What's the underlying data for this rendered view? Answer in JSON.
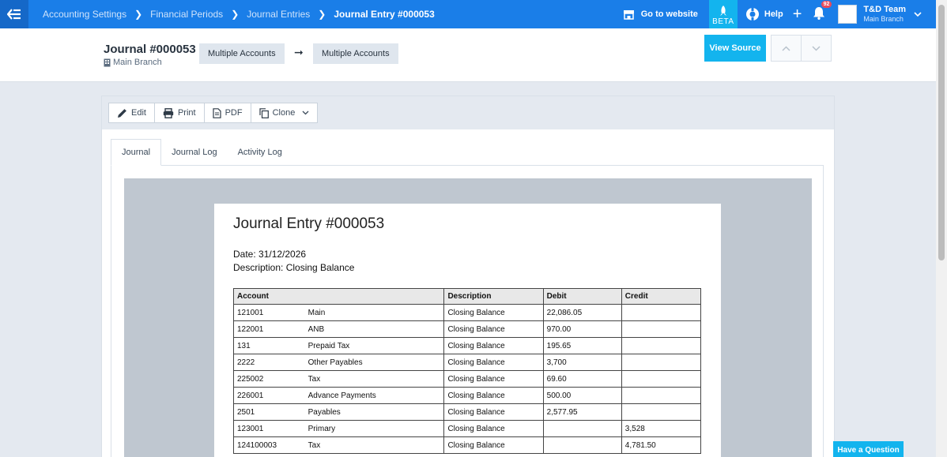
{
  "nav": {
    "menu_icon": "menu-arrow-left-icon",
    "breadcrumb": [
      "Accounting Settings",
      "Financial Periods",
      "Journal Entries",
      "Journal Entry #000053"
    ],
    "go_to_website": "Go to website",
    "beta": "BETA",
    "help": "Help",
    "notifications_count": "92",
    "user_name": "T&D Team",
    "user_branch": "Main Branch"
  },
  "header": {
    "title": "Journal #000053",
    "branch": "Main Branch",
    "from_tag": "Multiple Accounts",
    "to_tag": "Multiple Accounts",
    "view_source": "View Source"
  },
  "toolbar": {
    "edit": "Edit",
    "print": "Print",
    "pdf": "PDF",
    "clone": "Clone"
  },
  "tabs": [
    "Journal",
    "Journal Log",
    "Activity Log"
  ],
  "document": {
    "title": "Journal Entry #000053",
    "date_label": "Date: 31/12/2026",
    "description_label": "Description: Closing Balance",
    "columns": [
      "Account",
      "Description",
      "Debit",
      "Credit"
    ],
    "rows": [
      {
        "code": "121001",
        "name": "Main",
        "description": "Closing Balance",
        "debit": "22,086.05",
        "credit": ""
      },
      {
        "code": "122001",
        "name": "ANB",
        "description": "Closing Balance",
        "debit": "970.00",
        "credit": ""
      },
      {
        "code": "131",
        "name": "Prepaid Tax",
        "description": "Closing Balance",
        "debit": "195.65",
        "credit": ""
      },
      {
        "code": "2222",
        "name": "Other Payables",
        "description": "Closing Balance",
        "debit": "3,700",
        "credit": ""
      },
      {
        "code": "225002",
        "name": "Tax",
        "description": "Closing Balance",
        "debit": "69.60",
        "credit": ""
      },
      {
        "code": "226001",
        "name": "Advance Payments",
        "description": "Closing Balance",
        "debit": "500.00",
        "credit": ""
      },
      {
        "code": "2501",
        "name": "Payables",
        "description": "Closing Balance",
        "debit": "2,577.95",
        "credit": ""
      },
      {
        "code": "123001",
        "name": "Primary",
        "description": "Closing Balance",
        "debit": "",
        "credit": "3,528"
      },
      {
        "code": "124100003",
        "name": "Tax",
        "description": "Closing Balance",
        "debit": "",
        "credit": "4,781.50"
      }
    ]
  },
  "floating": {
    "have_question": "Have a Question"
  },
  "colors": {
    "topbar": "#1a7ee8",
    "accent": "#13b4ee",
    "background": "#e4e9f0"
  }
}
